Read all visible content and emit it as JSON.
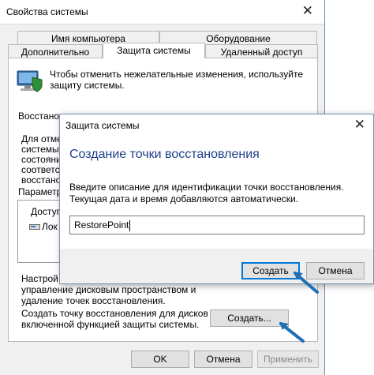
{
  "window": {
    "title": "Свойства системы",
    "close_glyph": "✕"
  },
  "tabs": {
    "row1": [
      "Имя компьютера",
      "Оборудование"
    ],
    "row2": [
      "Дополнительно",
      "Защита системы",
      "Удаленный доступ"
    ]
  },
  "panel": {
    "intro_line1": "Чтобы отменить нежелательные изменения, используйте",
    "intro_line2": "защиту системы.",
    "restore_label": "Восстановление",
    "hidden_text": [
      "Для отме",
      "системы в",
      "состояни",
      "соответст",
      "восстано"
    ],
    "params_label": "Параметры",
    "list_header": "Доступ",
    "list_item": "Лок",
    "config_line1": "Настрой",
    "config_line2": "управление дисковым пространством и",
    "config_line3": "удаление точек восстановления.",
    "create_line1": "Создать точку восстановления для дисков с",
    "create_line2": "включенной функцией защиты системы.",
    "create_button": "Создать..."
  },
  "footer": {
    "ok": "OK",
    "cancel": "Отмена",
    "apply": "Применить"
  },
  "dialog": {
    "title": "Защита системы",
    "close_glyph": "✕",
    "heading": "Создание точки восстановления",
    "description": "Введите описание для идентификации точки восстановления. Текущая дата и время добавляются автоматически.",
    "input_value": "RestorePoint",
    "create_button": "Создать",
    "cancel_button": "Отмена"
  },
  "colors": {
    "accent": "#0078d7",
    "arrow": "#1f6fb5",
    "heading": "#1e3f8a"
  }
}
